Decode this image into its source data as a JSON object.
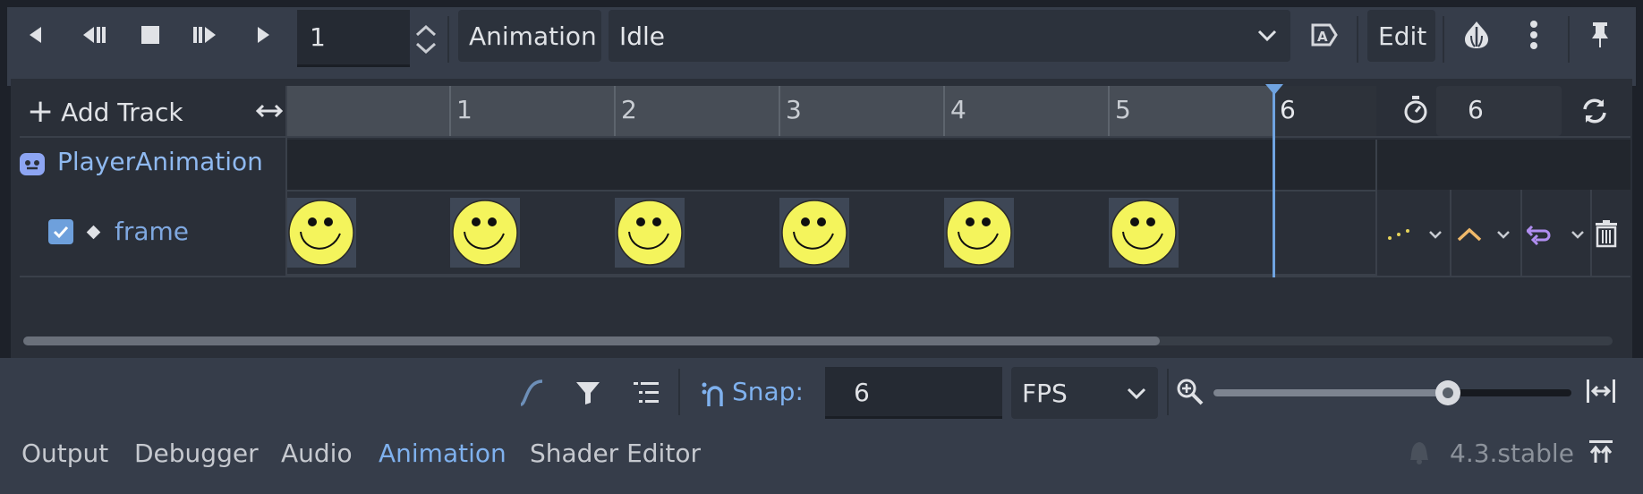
{
  "toolbar": {
    "frame_value": "1",
    "animation_label": "Animation",
    "animation_selected": "Idle",
    "edit_label": "Edit"
  },
  "timeline": {
    "add_track_label": "Add Track",
    "tick_labels": [
      "1",
      "2",
      "3",
      "4",
      "5"
    ],
    "playhead_label": "6",
    "length_value": "6"
  },
  "tracks": {
    "node_name": "PlayerAnimation",
    "track_name": "frame",
    "track_enabled": true,
    "keyframe_count": 6
  },
  "bottom_toolbar": {
    "snap_label": "Snap:",
    "snap_value": "6",
    "snap_unit": "FPS",
    "zoom_level": 0.65
  },
  "bottom_tabs": {
    "tabs": [
      "Output",
      "Debugger",
      "Audio",
      "Animation",
      "Shader Editor"
    ],
    "active": "Animation",
    "version": "4.3.stable"
  },
  "colors": {
    "accent": "#7fb1ee",
    "panel": "#2a2f38",
    "toolbar": "#363d4a",
    "playhead": "#6fa3e0",
    "smiley": "#f4f45c"
  },
  "icons": [
    "play-backwards-icon",
    "play-backwards-from-end-icon",
    "stop-icon",
    "play-from-start-icon",
    "play-icon",
    "autoplay-icon",
    "onion-skin-icon",
    "more-icon",
    "pin-icon",
    "expand-icon",
    "timer-icon",
    "loop-icon",
    "bezier-icon",
    "filter-icon",
    "list-icon",
    "snap-icon",
    "zoom-icon",
    "fit-icon"
  ]
}
